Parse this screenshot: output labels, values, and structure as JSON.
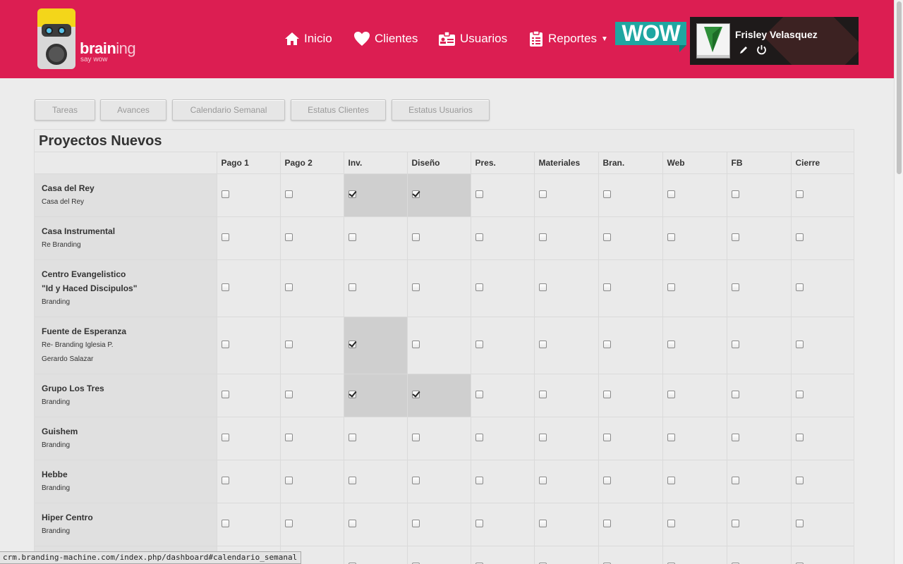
{
  "header": {
    "logo": {
      "name_bold": "brain",
      "name_light": "ing",
      "tagline": "say wow"
    },
    "nav": [
      {
        "label": "Inicio",
        "icon": "home-icon"
      },
      {
        "label": "Clientes",
        "icon": "heart-icon"
      },
      {
        "label": "Usuarios",
        "icon": "id-card-icon"
      },
      {
        "label": "Reportes",
        "icon": "clipboard-icon",
        "has_dropdown": true
      }
    ],
    "badge": "WOW",
    "user": {
      "name": "Frisley Velasquez"
    },
    "colors": {
      "brand": "#dc1e52",
      "accent": "#1fa6a1"
    }
  },
  "tabs": [
    "Tareas",
    "Avances",
    "Calendario Semanal",
    "Estatus Clientes",
    "Estatus Usuarios"
  ],
  "projects_table": {
    "title": "Proyectos Nuevos",
    "columns": [
      "Pago 1",
      "Pago 2",
      "Inv.",
      "Diseño",
      "Pres.",
      "Materiales",
      "Bran.",
      "Web",
      "FB",
      "Cierre"
    ],
    "rows": [
      {
        "name": "Casa del Rey",
        "details": [
          "Casa del Rey"
        ],
        "checked": [
          false,
          false,
          true,
          true,
          false,
          false,
          false,
          false,
          false,
          false
        ]
      },
      {
        "name": "Casa Instrumental",
        "details": [
          "Re Branding"
        ],
        "checked": [
          false,
          false,
          false,
          false,
          false,
          false,
          false,
          false,
          false,
          false
        ]
      },
      {
        "name": "Centro Evangelistico",
        "name2": "\"Id y Haced Discipulos\"",
        "details": [
          "Branding"
        ],
        "checked": [
          false,
          false,
          false,
          false,
          false,
          false,
          false,
          false,
          false,
          false
        ]
      },
      {
        "name": "Fuente de Esperanza",
        "details": [
          "Re- Branding Iglesia P.",
          "Gerardo Salazar"
        ],
        "checked": [
          false,
          false,
          true,
          false,
          false,
          false,
          false,
          false,
          false,
          false
        ]
      },
      {
        "name": "Grupo Los Tres",
        "details": [
          "Branding"
        ],
        "checked": [
          false,
          false,
          true,
          true,
          false,
          false,
          false,
          false,
          false,
          false
        ]
      },
      {
        "name": "Guishem",
        "details": [
          "Branding"
        ],
        "checked": [
          false,
          false,
          false,
          false,
          false,
          false,
          false,
          false,
          false,
          false
        ]
      },
      {
        "name": "Hebbe",
        "details": [
          "Branding"
        ],
        "checked": [
          false,
          false,
          false,
          false,
          false,
          false,
          false,
          false,
          false,
          false
        ]
      },
      {
        "name": "Hiper Centro",
        "details": [
          "Branding"
        ],
        "checked": [
          false,
          false,
          false,
          false,
          false,
          false,
          false,
          false,
          false,
          false
        ]
      },
      {
        "name": "",
        "details": [],
        "checked": [
          false,
          false,
          false,
          false,
          false,
          false,
          false,
          false,
          false,
          false
        ]
      }
    ]
  },
  "status_bar": {
    "url": "crm.branding-machine.com/index.php/dashboard#calendario_semanal"
  }
}
